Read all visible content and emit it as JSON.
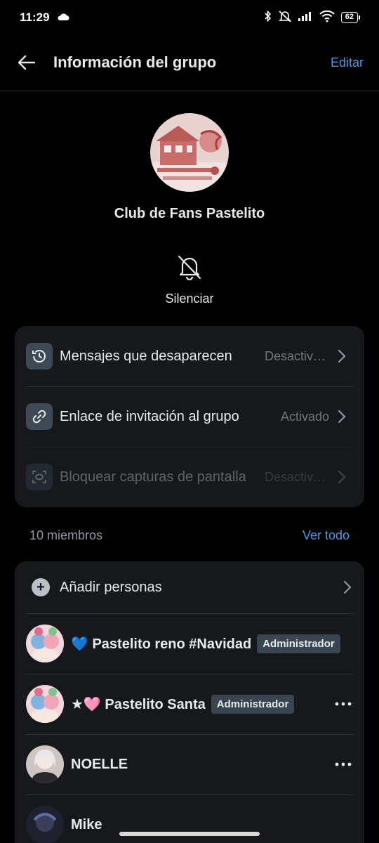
{
  "status_bar": {
    "time": "11:29",
    "battery": "62",
    "network": "6"
  },
  "app_bar": {
    "title": "Información del grupo",
    "edit_label": "Editar"
  },
  "group": {
    "name": "Club de Fans Pastelito",
    "mute_label": "Silenciar"
  },
  "settings": [
    {
      "label": "Mensajes que desaparecen",
      "value": "Desactivado",
      "icon": "timer-history-icon",
      "disabled": false
    },
    {
      "label": "Enlace de invitación al grupo",
      "value": "Activado",
      "icon": "link-icon",
      "disabled": false
    },
    {
      "label": "Bloquear capturas de pantalla",
      "value": "Desactivado",
      "icon": "screenshot-icon",
      "disabled": true
    }
  ],
  "members": {
    "count_label": "10 miembros",
    "see_all_label": "Ver todo",
    "add_label": "Añadir personas",
    "list": [
      {
        "name": "💙 Pastelito reno #Navidad",
        "badge": "Administrador",
        "show_more": false
      },
      {
        "name": "★🩷 Pastelito Santa",
        "badge": "Administrador",
        "show_more": true
      },
      {
        "name": "NOELLE",
        "badge": "",
        "show_more": true
      },
      {
        "name": "Mike",
        "badge": "",
        "show_more": false
      }
    ]
  },
  "colors": {
    "accent": "#4a99e9",
    "card": "#16181c",
    "background": "#000000",
    "badge": "#394550"
  }
}
